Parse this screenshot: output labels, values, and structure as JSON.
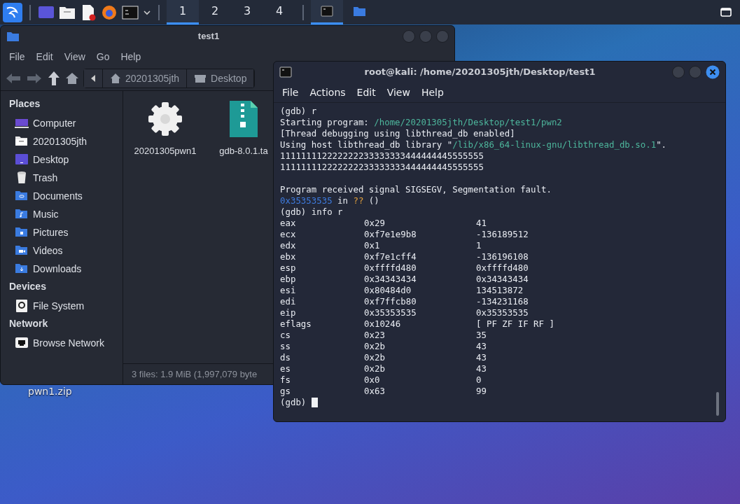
{
  "taskbar": {
    "workspaces": [
      {
        "label": "1",
        "selected": true
      },
      {
        "label": "2",
        "selected": false
      },
      {
        "label": "3",
        "selected": false
      },
      {
        "label": "4",
        "selected": false
      }
    ],
    "tasks": [
      {
        "kind": "terminal",
        "selected": true
      },
      {
        "kind": "folder",
        "selected": false
      }
    ]
  },
  "desktop_icons": [
    {
      "label": "pwn1.zip"
    }
  ],
  "file_manager": {
    "title": "test1",
    "menu": [
      "File",
      "Edit",
      "View",
      "Go",
      "Help"
    ],
    "breadcrumb": [
      {
        "label": "20201305jth",
        "kind": "home"
      },
      {
        "label": "Desktop",
        "kind": "desktop"
      }
    ],
    "sidebar": [
      {
        "title": "Places",
        "items": [
          {
            "label": "Computer",
            "kind": "computer"
          },
          {
            "label": "20201305jth",
            "kind": "home"
          },
          {
            "label": "Desktop",
            "kind": "desktop"
          },
          {
            "label": "Trash",
            "kind": "trash"
          },
          {
            "label": "Documents",
            "kind": "documents"
          },
          {
            "label": "Music",
            "kind": "music"
          },
          {
            "label": "Pictures",
            "kind": "pictures"
          },
          {
            "label": "Videos",
            "kind": "videos"
          },
          {
            "label": "Downloads",
            "kind": "downloads"
          }
        ]
      },
      {
        "title": "Devices",
        "items": [
          {
            "label": "File System",
            "kind": "drive"
          }
        ]
      },
      {
        "title": "Network",
        "items": [
          {
            "label": "Browse Network",
            "kind": "network"
          }
        ]
      }
    ],
    "files": [
      {
        "name": "20201305pwn1",
        "kind": "executable"
      },
      {
        "name": "gdb-8.0.1.ta",
        "kind": "archive"
      }
    ],
    "status": "3 files: 1.9 MiB (1,997,079 byte"
  },
  "terminal": {
    "title": "root@kali: /home/20201305jth/Desktop/test1",
    "menu": [
      "File",
      "Actions",
      "Edit",
      "View",
      "Help"
    ],
    "lines": [
      {
        "kind": "text",
        "parts": [
          {
            "text": "(gdb) r"
          }
        ]
      },
      {
        "kind": "text",
        "parts": [
          {
            "text": "Starting program: "
          },
          {
            "text": "/home/20201305jth/Desktop/test1/pwn2",
            "kind": "path"
          }
        ]
      },
      {
        "kind": "text",
        "parts": [
          {
            "text": "[Thread debugging using libthread_db enabled]"
          }
        ]
      },
      {
        "kind": "text",
        "parts": [
          {
            "text": "Using host libthread_db library \""
          },
          {
            "text": "/lib/x86_64-linux-gnu/libthread_db.so.1",
            "kind": "path"
          },
          {
            "text": "\"."
          }
        ]
      },
      {
        "kind": "text",
        "parts": [
          {
            "text": "111111112222222233333333444444445555555"
          }
        ]
      },
      {
        "kind": "text",
        "parts": [
          {
            "text": "111111112222222233333333444444445555555"
          }
        ]
      },
      {
        "kind": "blank"
      },
      {
        "kind": "text",
        "parts": [
          {
            "text": "Program received signal SIGSEGV, Segmentation fault."
          }
        ]
      },
      {
        "kind": "text",
        "parts": [
          {
            "text": "0x35353535",
            "kind": "address"
          },
          {
            "text": " in "
          },
          {
            "text": "??",
            "kind": "unknown"
          },
          {
            "text": " ()"
          }
        ]
      },
      {
        "kind": "text",
        "parts": [
          {
            "text": "(gdb) info r"
          }
        ]
      },
      {
        "kind": "register",
        "cells": [
          "eax",
          "0x29",
          "41"
        ]
      },
      {
        "kind": "register",
        "cells": [
          "ecx",
          "0xf7e1e9b8",
          "-136189512"
        ]
      },
      {
        "kind": "register",
        "cells": [
          "edx",
          "0x1",
          "1"
        ]
      },
      {
        "kind": "register",
        "cells": [
          "ebx",
          "0xf7e1cff4",
          "-136196108"
        ]
      },
      {
        "kind": "register",
        "cells": [
          "esp",
          "0xffffd480",
          "0xffffd480"
        ]
      },
      {
        "kind": "register",
        "cells": [
          "ebp",
          "0x34343434",
          "0x34343434"
        ]
      },
      {
        "kind": "register",
        "cells": [
          "esi",
          "0x80484d0",
          "134513872"
        ]
      },
      {
        "kind": "register",
        "cells": [
          "edi",
          "0xf7ffcb80",
          "-134231168"
        ]
      },
      {
        "kind": "register",
        "cells": [
          "eip",
          "0x35353535",
          "0x35353535"
        ]
      },
      {
        "kind": "register",
        "cells": [
          "eflags",
          "0x10246",
          "[ PF ZF IF RF ]"
        ]
      },
      {
        "kind": "register",
        "cells": [
          "cs",
          "0x23",
          "35"
        ]
      },
      {
        "kind": "register",
        "cells": [
          "ss",
          "0x2b",
          "43"
        ]
      },
      {
        "kind": "register",
        "cells": [
          "ds",
          "0x2b",
          "43"
        ]
      },
      {
        "kind": "register",
        "cells": [
          "es",
          "0x2b",
          "43"
        ]
      },
      {
        "kind": "register",
        "cells": [
          "fs",
          "0x0",
          "0"
        ]
      },
      {
        "kind": "register",
        "cells": [
          "gs",
          "0x63",
          "99"
        ]
      },
      {
        "kind": "cursor",
        "parts": [
          {
            "text": "(gdb)"
          }
        ]
      }
    ]
  }
}
